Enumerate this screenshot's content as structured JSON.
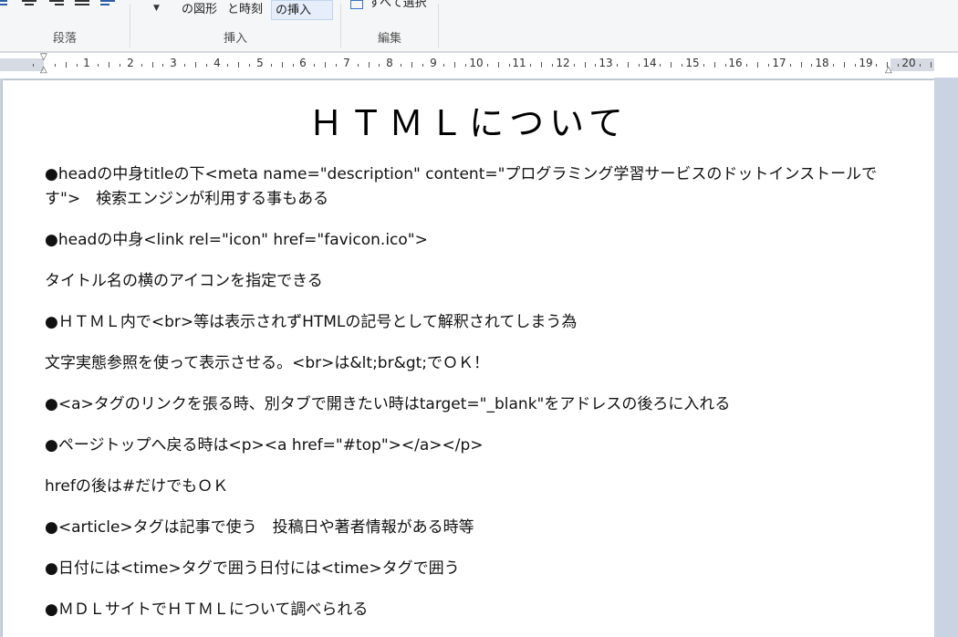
{
  "ribbon": {
    "groups": [
      {
        "label": "段落"
      },
      {
        "label": "挿入"
      },
      {
        "label": "編集"
      }
    ],
    "insert_buttons": [
      "の図形",
      "と時刻",
      "の挿入"
    ],
    "select_all_label": "すべて選択"
  },
  "ruler": {
    "numbers": [
      "1",
      "2",
      "3",
      "4",
      "5",
      "6",
      "7",
      "8",
      "9",
      "10",
      "11",
      "12",
      "13",
      "14",
      "15",
      "16",
      "17",
      "18",
      "19",
      "20"
    ]
  },
  "document": {
    "title": "ＨＴＭＬについて",
    "paragraphs": [
      "●headの中身titleの下<meta name=\"description\" content=\"プログラミング学習サービスのドットインストールです\">　検索エンジンが利用する事もある",
      "●headの中身<link rel=\"icon\" href=\"favicon.ico\">",
      "タイトル名の横のアイコンを指定できる",
      "●ＨＴＭＬ内で<br>等は表示されずHTMLの記号として解釈されてしまう為",
      "文字実態参照を使って表示させる。<br>は&lt;br&gt;でＯＫ！",
      "●<a>タグのリンクを張る時、別タブで開きたい時はtarget=\"_blank\"をアドレスの後ろに入れる",
      "●ページトップへ戻る時は<p><a href=\"#top\"></a></p>",
      "hrefの後は#だけでもＯＫ",
      "●<article>タグは記事で使う　投稿日や著者情報がある時等",
      "●日付には<time>タグで囲う日付には<time>タグで囲う",
      "●ＭＤＬサイトでＨＴＭＬについて調べられる"
    ]
  }
}
